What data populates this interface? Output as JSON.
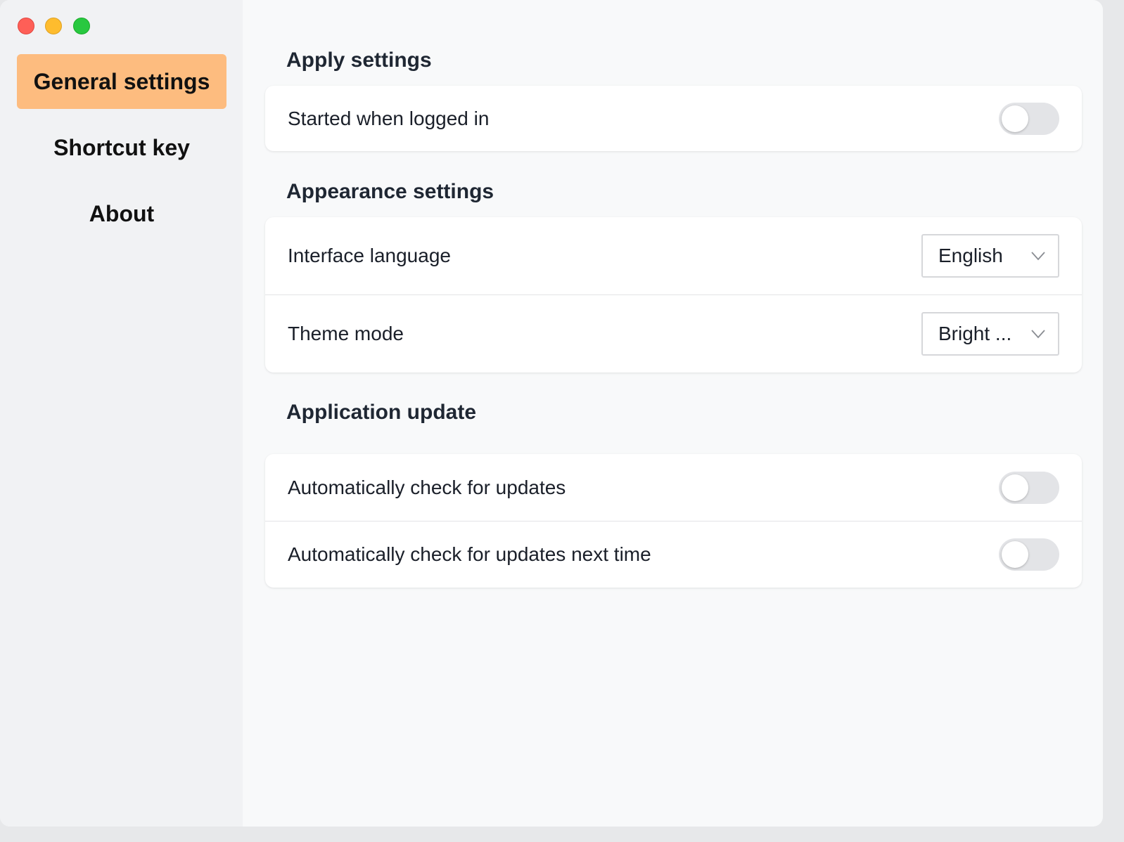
{
  "window": {
    "controls": [
      "close",
      "minimize",
      "zoom"
    ]
  },
  "sidebar": {
    "items": [
      {
        "label": "General settings",
        "active": true
      },
      {
        "label": "Shortcut key",
        "active": false
      },
      {
        "label": "About",
        "active": false
      }
    ]
  },
  "sections": {
    "apply": {
      "title": "Apply settings",
      "started_when_logged_in": {
        "label": "Started when logged in",
        "enabled": false
      }
    },
    "appearance": {
      "title": "Appearance settings",
      "interface_language": {
        "label": "Interface language",
        "value": "English"
      },
      "theme_mode": {
        "label": "Theme mode",
        "value": "Bright ..."
      }
    },
    "update": {
      "title": "Application update",
      "auto_check": {
        "label": "Automatically check for updates",
        "enabled": false
      },
      "auto_check_next_time": {
        "label": "Automatically check for updates next time",
        "enabled": false
      }
    }
  },
  "colors": {
    "active_nav": "#fdbc7f",
    "sidebar_bg": "#f1f2f4",
    "main_bg": "#f8f9fa",
    "toggle_off": "#e3e4e7"
  },
  "icons": {
    "close": "close-window-icon",
    "minimize": "minimize-window-icon",
    "zoom": "zoom-window-icon",
    "caret": "chevron-down-icon"
  }
}
